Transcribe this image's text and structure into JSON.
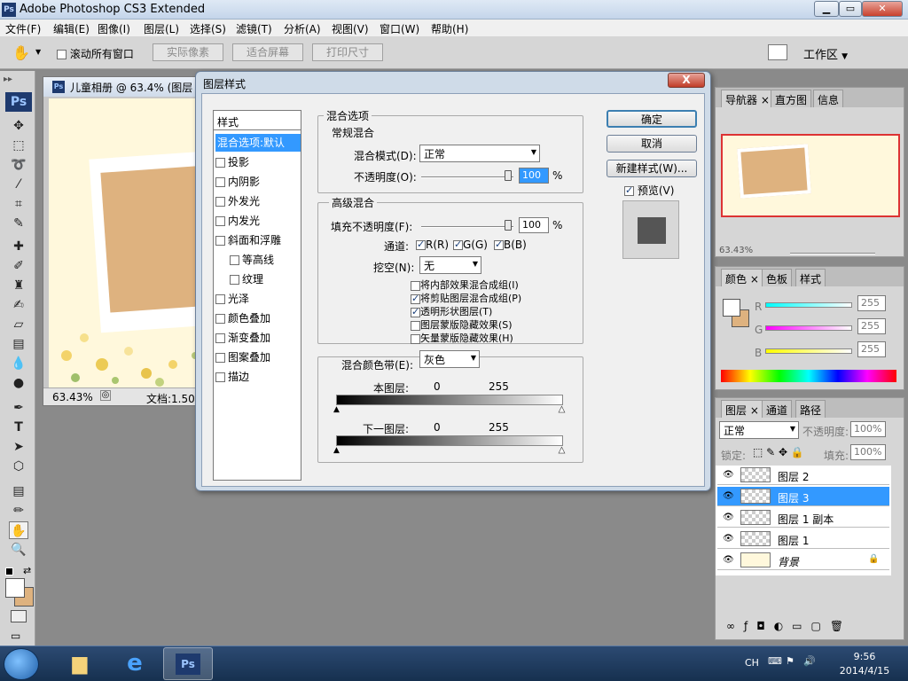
{
  "app": {
    "title": "Adobe Photoshop CS3 Extended",
    "logo": "Ps"
  },
  "menu": [
    "文件(F)",
    "编辑(E)",
    "图像(I)",
    "图层(L)",
    "选择(S)",
    "滤镜(T)",
    "分析(A)",
    "视图(V)",
    "窗口(W)",
    "帮助(H)"
  ],
  "options": {
    "scroll_all": "滚动所有窗口",
    "actual_pixels": "实际像素",
    "fit_screen": "适合屏幕",
    "print_size": "打印尺寸",
    "workspace": "工作区"
  },
  "document": {
    "tab_title": "儿童相册 @ 63.4% (图层",
    "zoom": "63.43%",
    "doc_info": "文档:1.50M"
  },
  "dialog": {
    "title": "图层样式",
    "close": "X",
    "styles_header": "样式",
    "styles": [
      {
        "label": "混合选项:默认",
        "checkbox": false,
        "selected": true,
        "indent": false
      },
      {
        "label": "投影",
        "checkbox": true,
        "selected": false,
        "indent": false
      },
      {
        "label": "内阴影",
        "checkbox": true,
        "selected": false,
        "indent": false
      },
      {
        "label": "外发光",
        "checkbox": true,
        "selected": false,
        "indent": false
      },
      {
        "label": "内发光",
        "checkbox": true,
        "selected": false,
        "indent": false
      },
      {
        "label": "斜面和浮雕",
        "checkbox": true,
        "selected": false,
        "indent": false
      },
      {
        "label": "等高线",
        "checkbox": true,
        "selected": false,
        "indent": true
      },
      {
        "label": "纹理",
        "checkbox": true,
        "selected": false,
        "indent": true
      },
      {
        "label": "光泽",
        "checkbox": true,
        "selected": false,
        "indent": false
      },
      {
        "label": "颜色叠加",
        "checkbox": true,
        "selected": false,
        "indent": false
      },
      {
        "label": "渐变叠加",
        "checkbox": true,
        "selected": false,
        "indent": false
      },
      {
        "label": "图案叠加",
        "checkbox": true,
        "selected": false,
        "indent": false
      },
      {
        "label": "描边",
        "checkbox": true,
        "selected": false,
        "indent": false
      }
    ],
    "blend_options": "混合选项",
    "general_blending": "常规混合",
    "blend_mode_label": "混合模式(D):",
    "blend_mode_value": "正常",
    "opacity_label": "不透明度(O):",
    "opacity_value": "100",
    "percent": "%",
    "advanced_blending": "高级混合",
    "fill_opacity_label": "填充不透明度(F):",
    "fill_opacity_value": "100",
    "channels_label": "通道:",
    "channel_r": "R(R)",
    "channel_g": "G(G)",
    "channel_b": "B(B)",
    "knockout_label": "挖空(N):",
    "knockout_value": "无",
    "adv_options": [
      {
        "label": "将内部效果混合成组(I)",
        "checked": false
      },
      {
        "label": "将剪贴图层混合成组(P)",
        "checked": true
      },
      {
        "label": "透明形状图层(T)",
        "checked": true
      },
      {
        "label": "图层蒙版隐藏效果(S)",
        "checked": false
      },
      {
        "label": "矢量蒙版隐藏效果(H)",
        "checked": false
      }
    ],
    "blend_if_label": "混合颜色带(E):",
    "blend_if_value": "灰色",
    "this_layer": "本图层:",
    "underlying_layer": "下一图层:",
    "range_min": "0",
    "range_max": "255",
    "ok": "确定",
    "cancel": "取消",
    "new_style": "新建样式(W)...",
    "preview": "预览(V)"
  },
  "panels": {
    "nav_tabs": [
      "导航器",
      "直方图",
      "信息"
    ],
    "nav_zoom": "63.43%",
    "color_tabs": [
      "颜色",
      "色板",
      "样式"
    ],
    "color_r_label": "R",
    "color_g_label": "G",
    "color_b_label": "B",
    "color_r": "255",
    "color_g": "255",
    "color_b": "255",
    "layer_tabs": [
      "图层",
      "通道",
      "路径"
    ],
    "layer_blend": "正常",
    "layer_opacity_label": "不透明度:",
    "layer_opacity": "100%",
    "lock_label": "锁定:",
    "fill_label": "填充:",
    "fill_value": "100%",
    "layers": [
      {
        "name": "图层 2",
        "selected": false
      },
      {
        "name": "图层 3",
        "selected": true
      },
      {
        "name": "图层 1 副本",
        "selected": false
      },
      {
        "name": "图层 1",
        "selected": false
      },
      {
        "name": "背景",
        "selected": false
      }
    ]
  },
  "taskbar": {
    "ps_label": "Ps",
    "lang": "CH",
    "time": "9:56",
    "date": "2014/4/15"
  },
  "colors": {
    "selection": "#3399ff",
    "photo": "#deb27f",
    "canvas": "#fff8dc"
  }
}
